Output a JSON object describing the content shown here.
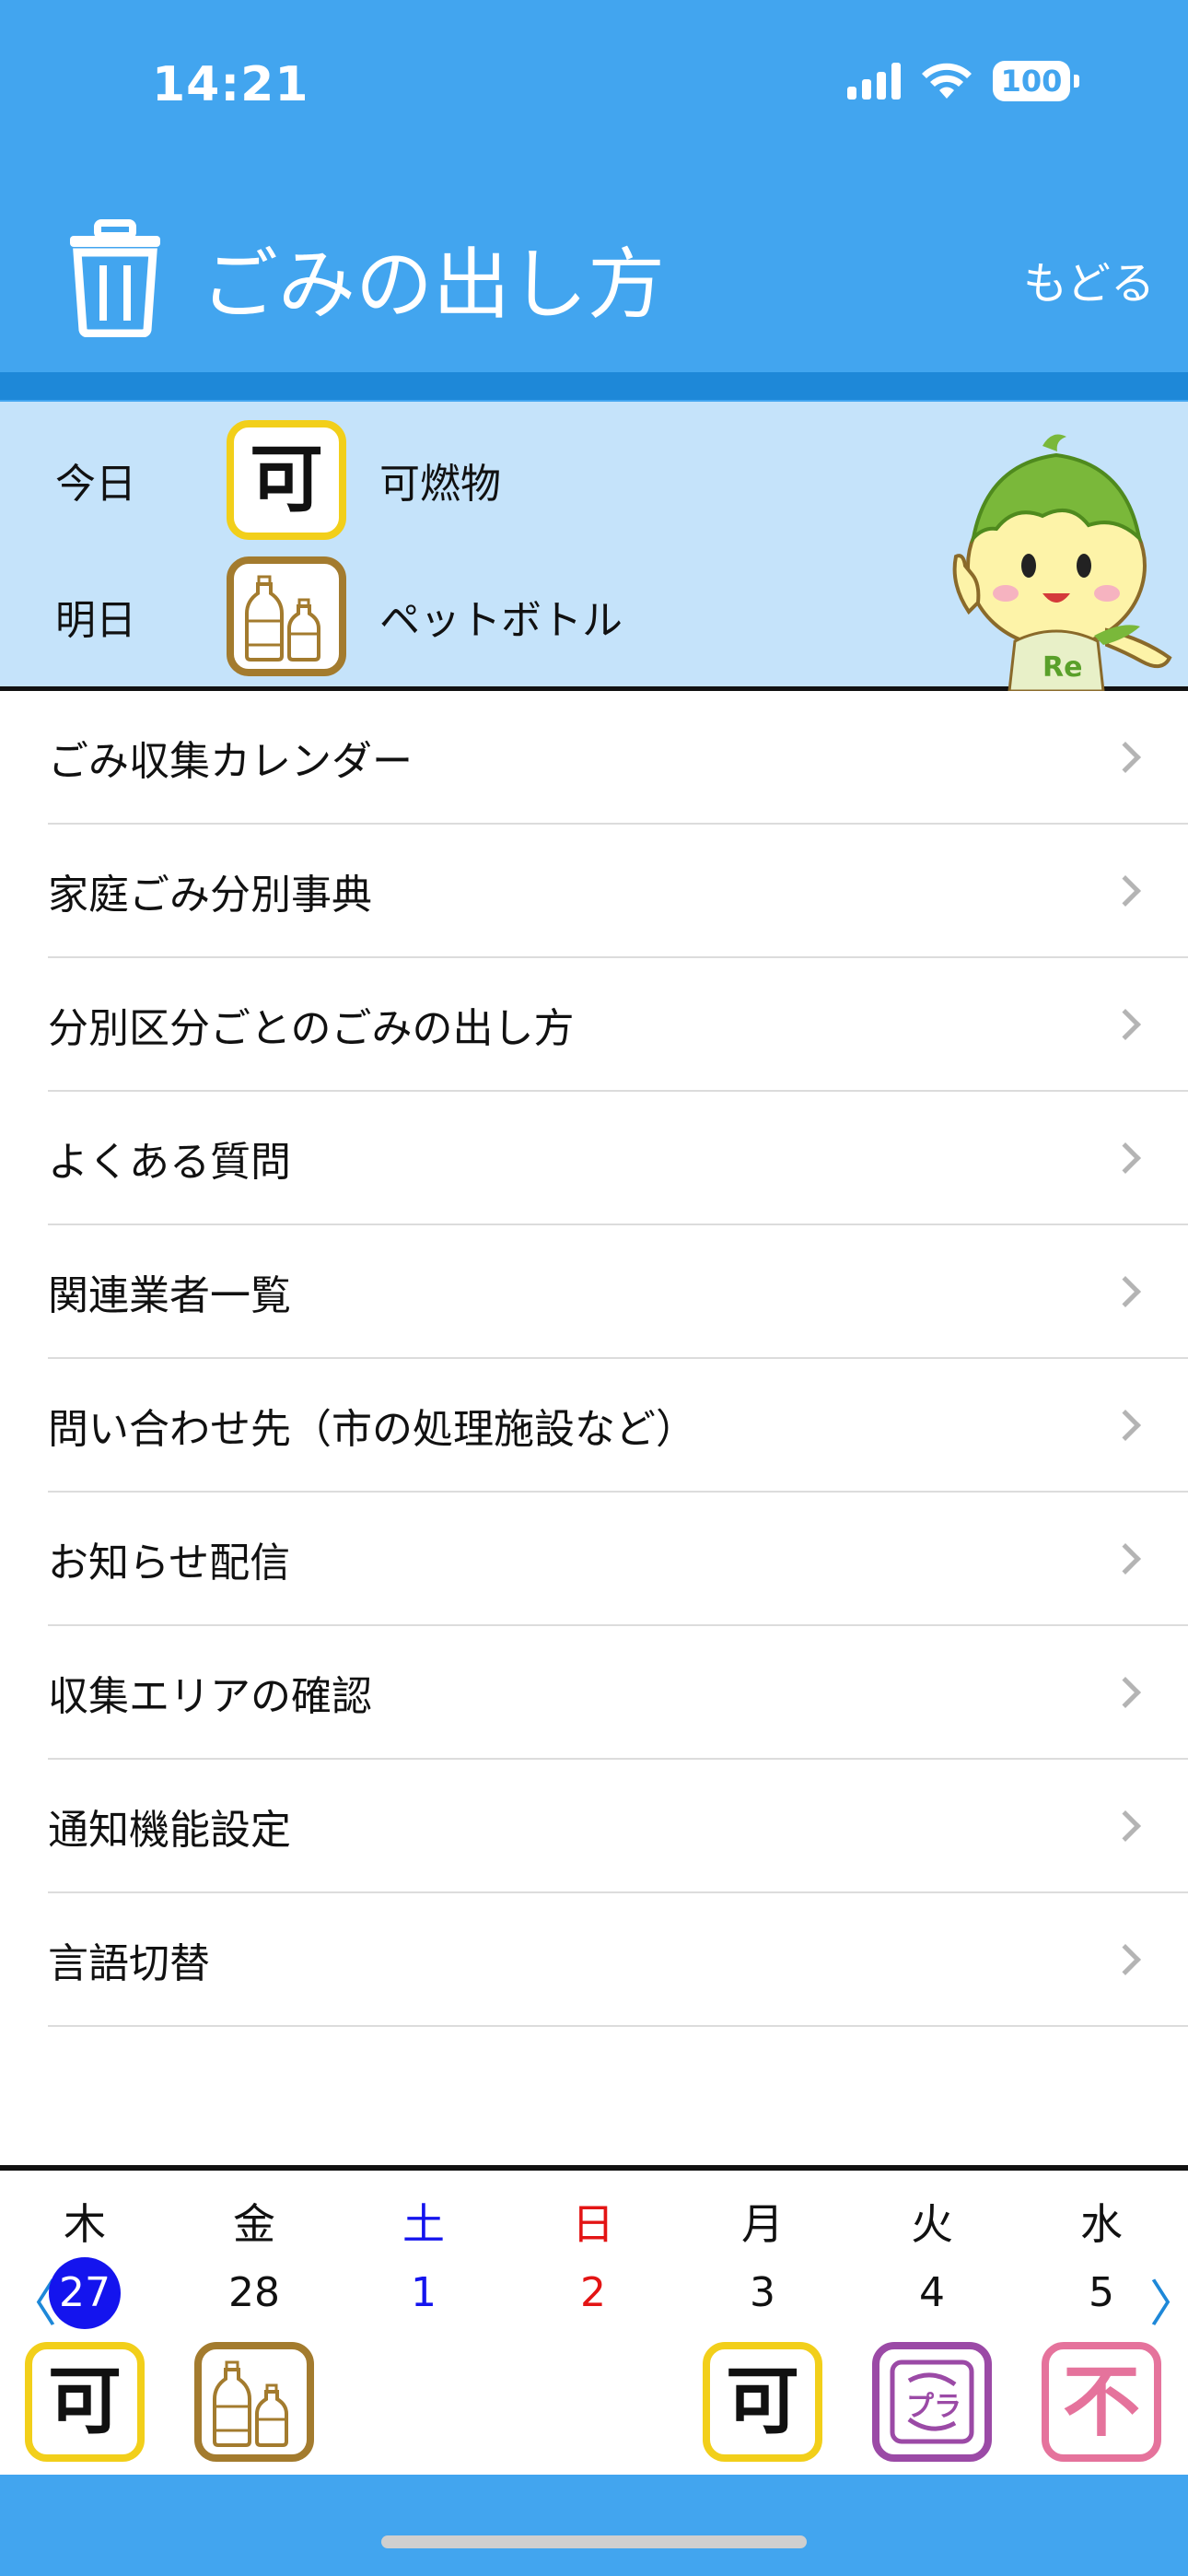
{
  "status_bar": {
    "time": "14:21",
    "battery": "100"
  },
  "header": {
    "title": "ごみの出し方",
    "back_label": "もどる"
  },
  "schedule": {
    "today": {
      "label": "今日",
      "type": "可燃物",
      "icon": "burnable-icon",
      "icon_char": "可"
    },
    "tomorrow": {
      "label": "明日",
      "type": "ペットボトル",
      "icon": "pet-bottle-icon"
    }
  },
  "menu": [
    {
      "label": "ごみ収集カレンダー"
    },
    {
      "label": "家庭ごみ分別事典"
    },
    {
      "label": "分別区分ごとのごみの出し方"
    },
    {
      "label": "よくある質問"
    },
    {
      "label": "関連業者一覧"
    },
    {
      "label": "問い合わせ先（市の処理施設など）"
    },
    {
      "label": "お知らせ配信"
    },
    {
      "label": "収集エリアの確認"
    },
    {
      "label": "通知機能設定"
    },
    {
      "label": "言語切替"
    }
  ],
  "calendar": {
    "prev_arrow": "〈",
    "next_arrow": "〉",
    "days": [
      {
        "weekday": "木",
        "date": "27",
        "today": true,
        "icon": "burnable-icon",
        "icon_char": "可",
        "weekday_color": "#111111"
      },
      {
        "weekday": "金",
        "date": "28",
        "icon": "pet-bottle-icon",
        "weekday_color": "#111111"
      },
      {
        "weekday": "土",
        "date": "1",
        "icon": "",
        "weekday_color": "#1414ee",
        "date_color": "#1414ee"
      },
      {
        "weekday": "日",
        "date": "2",
        "icon": "",
        "weekday_color": "#e31414",
        "date_color": "#e31414"
      },
      {
        "weekday": "月",
        "date": "3",
        "icon": "burnable-icon",
        "icon_char": "可",
        "weekday_color": "#111111"
      },
      {
        "weekday": "火",
        "date": "4",
        "icon": "plastic-icon",
        "icon_char": "プラ",
        "weekday_color": "#111111"
      },
      {
        "weekday": "水",
        "date": "5",
        "icon": "non-burnable-icon",
        "icon_char": "不",
        "weekday_color": "#111111"
      }
    ]
  },
  "colors": {
    "header_bg": "#42a5ef",
    "today_panel_bg": "#c5e3fa",
    "burnable_border": "#f2cf1a",
    "pet_bottle_border": "#a37b2e",
    "plastic_border": "#9b4aa6",
    "non_burnable_border": "#e5739c",
    "today_circle": "#1414ee"
  }
}
